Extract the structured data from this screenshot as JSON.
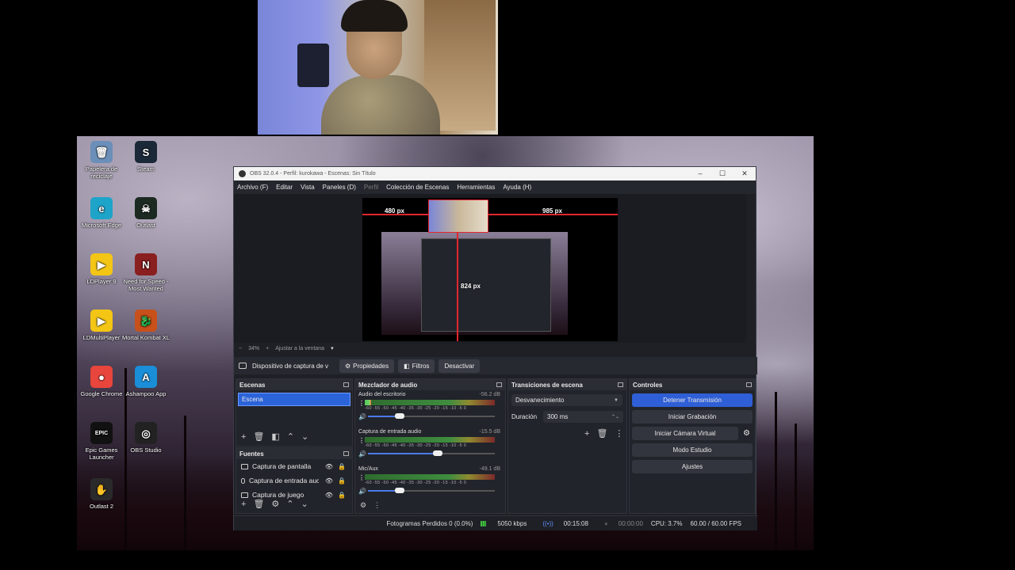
{
  "desktop_icons": [
    {
      "label": "Papelera de reciclaje",
      "icon": "recycle-bin-icon",
      "color": "#6b8fb8",
      "glyph": "🗑"
    },
    {
      "label": "Steam",
      "icon": "steam-icon",
      "color": "#1b2838",
      "glyph": "S"
    },
    {
      "label": "Microsoft Edge",
      "icon": "edge-icon",
      "color": "#1ea4c9",
      "glyph": "e"
    },
    {
      "label": "Outlast",
      "icon": "outlast-icon",
      "color": "#1c2a22",
      "glyph": "☠"
    },
    {
      "label": "LDPlayer 9",
      "icon": "ldplayer-icon",
      "color": "#f3c515",
      "glyph": "▶"
    },
    {
      "label": "Need for Speed - Most Wanted",
      "icon": "nfs-icon",
      "color": "#8a1f1f",
      "glyph": "N"
    },
    {
      "label": "LDMultiPlayer",
      "icon": "ldmultiplayer-icon",
      "color": "#f3c515",
      "glyph": "▶"
    },
    {
      "label": "Mortal Kombat XL",
      "icon": "mortal-kombat-icon",
      "color": "#c8501a",
      "glyph": "🐉"
    },
    {
      "label": "Google Chrome",
      "icon": "chrome-icon",
      "color": "#e8453c",
      "glyph": "●"
    },
    {
      "label": "Ashampoo App",
      "icon": "ashampoo-icon",
      "color": "#1a8ed8",
      "glyph": "A"
    },
    {
      "label": "Epic Games Launcher",
      "icon": "epic-games-icon",
      "color": "#111111",
      "glyph": "EPIC"
    },
    {
      "label": "OBS Studio",
      "icon": "obs-icon",
      "color": "#222222",
      "glyph": "◎"
    },
    {
      "label": "Outlast 2",
      "icon": "outlast2-icon",
      "color": "#2a2a2a",
      "glyph": "✋"
    }
  ],
  "obs": {
    "title": "OBS 32.0.4 - Perfil: kurokawa - Escenas: Sin Título",
    "menu": [
      "Archivo (F)",
      "Editar",
      "Vista",
      "Paneles (D)",
      "Perfil",
      "Colección de Escenas",
      "Herramientas",
      "Ayuda (H)"
    ],
    "guides": {
      "left": "480 px",
      "right": "985 px",
      "bottom": "824 px"
    },
    "zoom": {
      "minus": "−",
      "value": "34%",
      "plus": "+",
      "fit": "Ajustar a la ventana"
    },
    "source_bar": {
      "name": "Dispositivo de captura de v",
      "properties": "Propiedades",
      "filters": "Filtros",
      "deactivate": "Desactivar"
    },
    "scenes": {
      "title": "Escenas",
      "items": [
        "Escena"
      ]
    },
    "sources": {
      "title": "Fuentes",
      "items": [
        "Captura de pantalla",
        "Captura de entrada auc",
        "Captura de juego"
      ]
    },
    "mixer": {
      "title": "Mezclador de audio",
      "ticks": "-60 -55 -50 -45 -40 -35 -30 -25 -20 -15 -10 -5 0",
      "channels": [
        {
          "name": "Audio del escritorio",
          "db": "-56.2 dB",
          "level": 0.05,
          "volume": 0.25
        },
        {
          "name": "Captura de entrada audio",
          "db": "-15.5 dB",
          "level": 0.0,
          "volume": 0.55
        },
        {
          "name": "Mic/Aux",
          "db": "-49.1 dB",
          "level": 0.0,
          "volume": 0.25
        }
      ]
    },
    "transitions": {
      "title": "Transiciones de escena",
      "selected": "Desvanecimiento",
      "duration_label": "Duración",
      "duration_value": "300 ms"
    },
    "controls": {
      "title": "Controles",
      "stop_stream": "Detener Transmisión",
      "start_record": "Iniciar Grabación",
      "virtual_cam": "Iniciar Cámara Virtual",
      "studio_mode": "Modo Estudio",
      "settings": "Ajustes"
    },
    "status": {
      "dropped": "Fotogramas Perdidos 0 (0.0%)",
      "bitrate": "5050 kbps",
      "stream_time": "00:15:08",
      "rec_time": "00:00:00",
      "cpu": "CPU: 3.7%",
      "fps": "60.00 / 60.00 FPS"
    }
  },
  "colors": {
    "accent": "#2f5fd6",
    "guide": "#e2262f"
  }
}
